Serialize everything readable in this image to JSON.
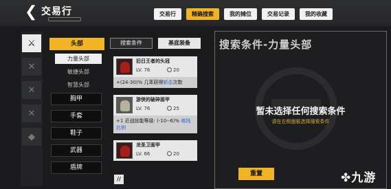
{
  "header": {
    "back_icon": "back-arrow-icon",
    "title": "交易行",
    "tabs": [
      {
        "label": "交易行",
        "active": false
      },
      {
        "label": "精确搜索",
        "active": true
      },
      {
        "label": "我的摊位",
        "active": false
      },
      {
        "label": "交易记录",
        "active": false
      },
      {
        "label": "我的收藏",
        "active": false
      }
    ]
  },
  "side_icons": [
    "sword-icon",
    "axe-icon",
    "blade-icon",
    "staff-icon",
    "gem-icon"
  ],
  "category": {
    "head": "头部",
    "sub_items": [
      {
        "label": "力量头部",
        "active": true
      },
      {
        "label": "敏捷头部",
        "active": false
      },
      {
        "label": "智慧头部",
        "active": false
      }
    ],
    "items": [
      "胸甲",
      "手套",
      "鞋子",
      "武器",
      "盾牌"
    ]
  },
  "list_tabs": [
    {
      "label": "搜索条件",
      "active": false
    },
    {
      "label": "基底装备",
      "active": true
    }
  ],
  "equipment": [
    {
      "name": "旧日王者的头冠",
      "lv": "LV. 76",
      "weight": "20",
      "effect_pre": "+(24-30)% 几率获得",
      "effect_hl": "斩击",
      "effect_post": "次数",
      "style": "red"
    },
    {
      "name": "游侠的破碎面甲",
      "lv": "LV. 76",
      "weight": "25",
      "effect_pre": "+1 近战技能等级: (-10--6)% ",
      "effect_hl": "格挡比例",
      "effect_post": "",
      "style": "metal"
    },
    {
      "name": "龙圣卫面甲",
      "lv": "LV. 66",
      "weight": "20",
      "effect_pre": "",
      "effect_hl": "",
      "effect_post": "",
      "style": "red"
    }
  ],
  "list_button": "//",
  "right_panel": {
    "title": "搜索条件-力量头部",
    "message": "暂未选择任何搜索条件",
    "hint": "请在左侧面板选择搜索条件",
    "reset_label": "重置"
  },
  "logo": "九游",
  "colors": {
    "accent": "#f2b326",
    "highlight": "#2a5fd6",
    "hint": "#d7ad3e"
  }
}
